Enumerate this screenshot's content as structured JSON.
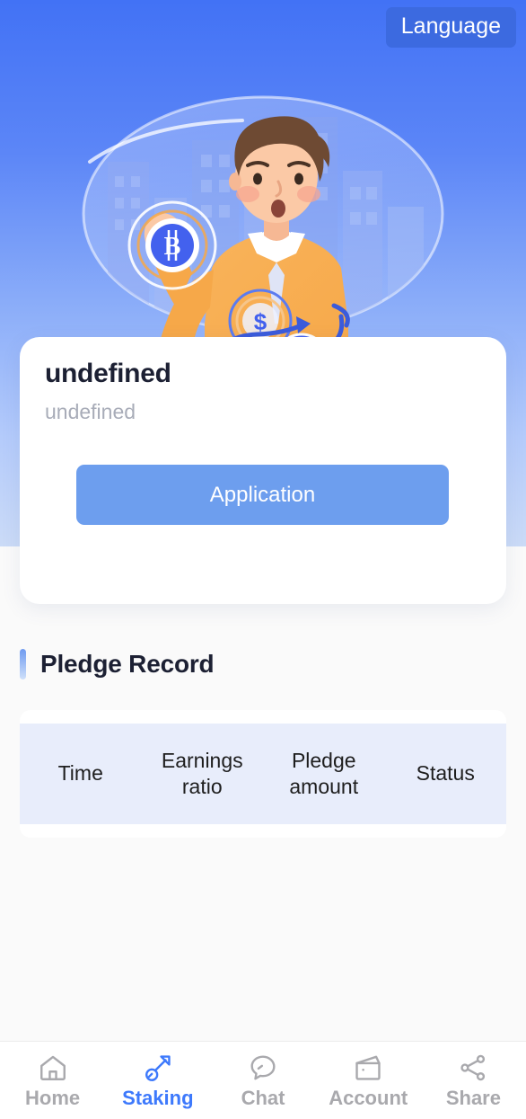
{
  "header": {
    "language_button": "Language"
  },
  "hero": {
    "illustration_name": "crypto-exchange-illustration"
  },
  "card": {
    "title": "undefined",
    "subtitle": "undefined",
    "action_button": "Application"
  },
  "pledge_record": {
    "section_title": "Pledge Record",
    "columns": [
      "Time",
      "Earnings ratio",
      "Pledge amount",
      "Status"
    ],
    "rows": []
  },
  "tabbar": {
    "items": [
      {
        "label": "Home",
        "icon": "home-icon",
        "active": false
      },
      {
        "label": "Staking",
        "icon": "shovel-icon",
        "active": true
      },
      {
        "label": "Chat",
        "icon": "chat-icon",
        "active": false
      },
      {
        "label": "Account",
        "icon": "wallet-icon",
        "active": false
      },
      {
        "label": "Share",
        "icon": "share-icon",
        "active": false
      }
    ]
  },
  "colors": {
    "gradient_top": "#4272f5",
    "gradient_bottom": "#cbdbf7",
    "accent_blue": "#3d79fc",
    "button_blue": "#6d9eee",
    "language_button": "#3c6ae0",
    "table_header_bg": "#e8edfb",
    "page_bg": "#fafafa",
    "inactive_gray": "#a9a9ad"
  }
}
